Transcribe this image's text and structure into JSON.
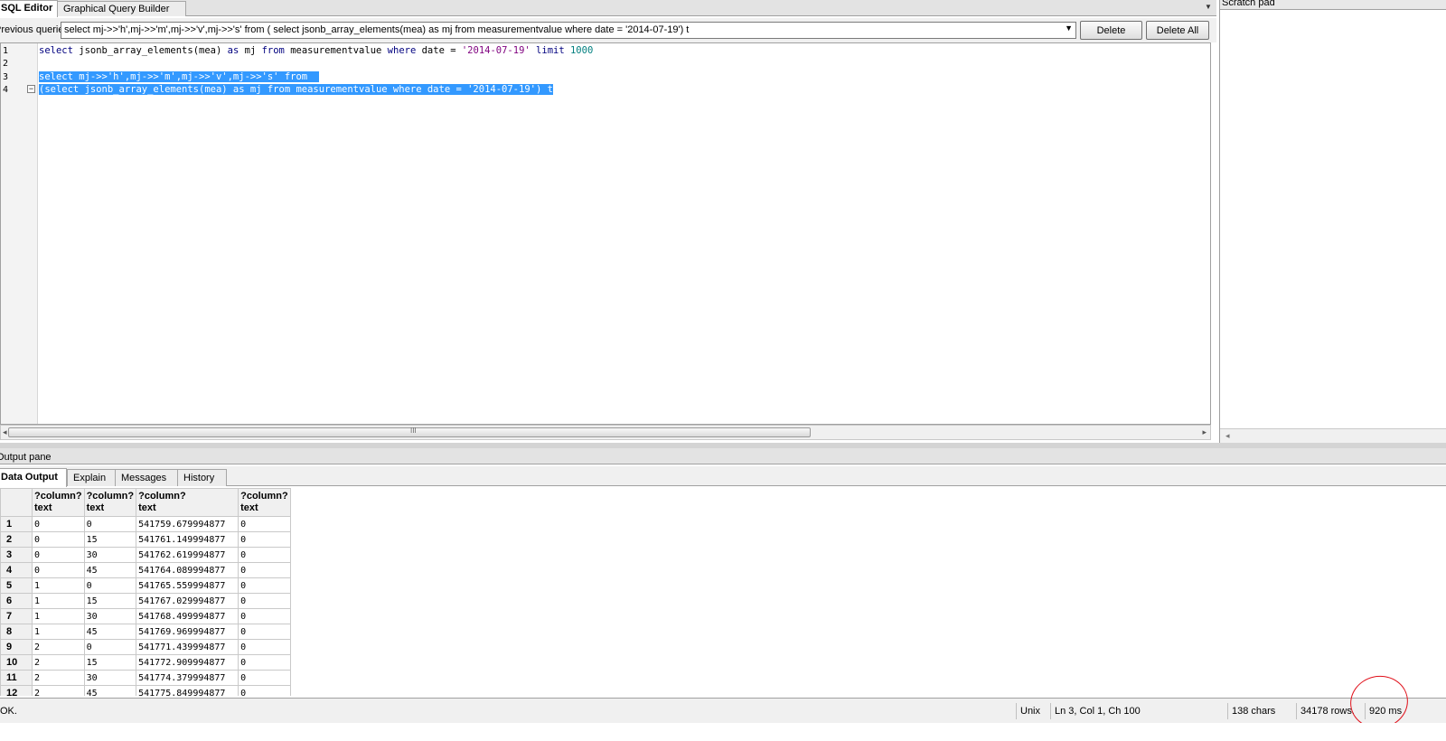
{
  "editor_tabs": {
    "sql_editor": "SQL Editor",
    "graphical_query_builder": "Graphical Query Builder",
    "menu_icon": "dropdown-menu-icon"
  },
  "previous_queries": {
    "label": "Previous queries",
    "selected": "select mj->>'h',mj->>'m',mj->>'v',mj->>'s' from ( select jsonb_array_elements(mea) as mj from measurementvalue where date = '2014-07-19') t",
    "delete_label": "Delete",
    "delete_all_label": "Delete All"
  },
  "editor": {
    "line_numbers": [
      "1",
      "2",
      "3",
      "4"
    ],
    "line1": {
      "t1": "select",
      "t2": " jsonb_array_elements(mea) ",
      "t3": "as",
      "t4": " mj ",
      "t5": "from",
      "t6": " measurementvalue ",
      "t7": "where",
      "t8": " date = ",
      "t9": "'2014-07-19'",
      "t10": " ",
      "t11": "limit",
      "t12": " ",
      "t13": "1000"
    },
    "line3": "select mj->>'h',mj->>'m',mj->>'v',mj->>'s' from",
    "line4": "(select jsonb_array_elements(mea) as mj from measurementvalue where date = '2014-07-19') t",
    "fold_symbol": "−",
    "scroll_grip": "III"
  },
  "scratch_pad": {
    "title": "Scratch pad"
  },
  "output_pane": {
    "title": "Output pane",
    "tabs": [
      "Data Output",
      "Explain",
      "Messages",
      "History"
    ],
    "columns": [
      {
        "name": "?column?",
        "type": "text"
      },
      {
        "name": "?column?",
        "type": "text"
      },
      {
        "name": "?column?",
        "type": "text"
      },
      {
        "name": "?column?",
        "type": "text"
      }
    ],
    "rows": [
      {
        "n": "1",
        "c": [
          "0",
          "0",
          "541759.679994877",
          "0"
        ]
      },
      {
        "n": "2",
        "c": [
          "0",
          "15",
          "541761.149994877",
          "0"
        ]
      },
      {
        "n": "3",
        "c": [
          "0",
          "30",
          "541762.619994877",
          "0"
        ]
      },
      {
        "n": "4",
        "c": [
          "0",
          "45",
          "541764.089994877",
          "0"
        ]
      },
      {
        "n": "5",
        "c": [
          "1",
          "0",
          "541765.559994877",
          "0"
        ]
      },
      {
        "n": "6",
        "c": [
          "1",
          "15",
          "541767.029994877",
          "0"
        ]
      },
      {
        "n": "7",
        "c": [
          "1",
          "30",
          "541768.499994877",
          "0"
        ]
      },
      {
        "n": "8",
        "c": [
          "1",
          "45",
          "541769.969994877",
          "0"
        ]
      },
      {
        "n": "9",
        "c": [
          "2",
          "0",
          "541771.439994877",
          "0"
        ]
      },
      {
        "n": "10",
        "c": [
          "2",
          "15",
          "541772.909994877",
          "0"
        ]
      },
      {
        "n": "11",
        "c": [
          "2",
          "30",
          "541774.379994877",
          "0"
        ]
      },
      {
        "n": "12",
        "c": [
          "2",
          "45",
          "541775.849994877",
          "0"
        ]
      }
    ]
  },
  "status_bar": {
    "message": "OK.",
    "line_ending": "Unix",
    "cursor_position": "Ln 3, Col 1, Ch 100",
    "chars": "138 chars",
    "rows": "34178 rows.",
    "elapsed": "920 ms"
  },
  "colors": {
    "selection": "#3399ff",
    "keyword": "#00007f",
    "string": "#7f007f",
    "number": "#007f7f",
    "annotation_circle": "#e0101a"
  }
}
